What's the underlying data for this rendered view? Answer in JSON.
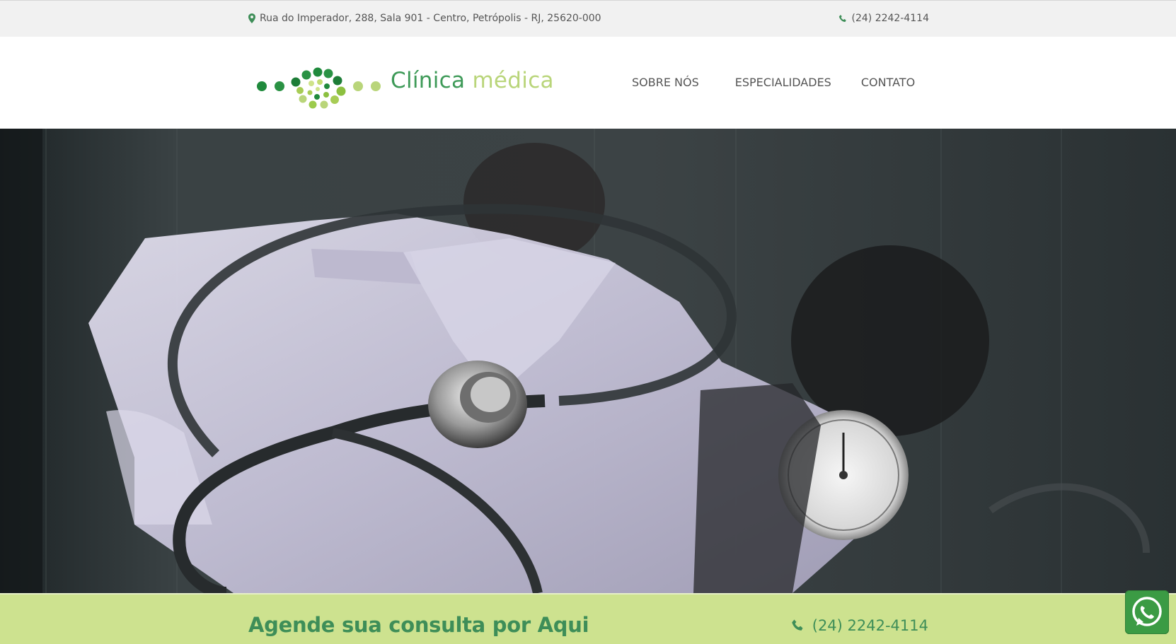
{
  "topbar": {
    "address_icon": "map-marker-icon",
    "address": "Rua do Imperador, 288, Sala 901 - Centro, Petrópolis - RJ, 25620-000",
    "phone_icon": "phone-icon",
    "phone": "(24) 2242-4114"
  },
  "header": {
    "logo_word1": "Clínica",
    "logo_word2": "médica",
    "nav": [
      "SOBRE NÓS",
      "ESPECIALIDADES",
      "CONTATO"
    ]
  },
  "hero": {
    "image": "doctor-coat-stethoscope-blood-pressure-photo"
  },
  "cta_bar": {
    "text": "Agende sua consulta por Aqui",
    "phone_icon": "phone-icon",
    "phone": "(24) 2242-4114"
  },
  "whatsapp": {
    "icon": "whatsapp-icon"
  },
  "colors": {
    "brand_green": "#3e8e58",
    "light_green": "#cde28f",
    "topbar_bg": "#f1f1f1"
  }
}
